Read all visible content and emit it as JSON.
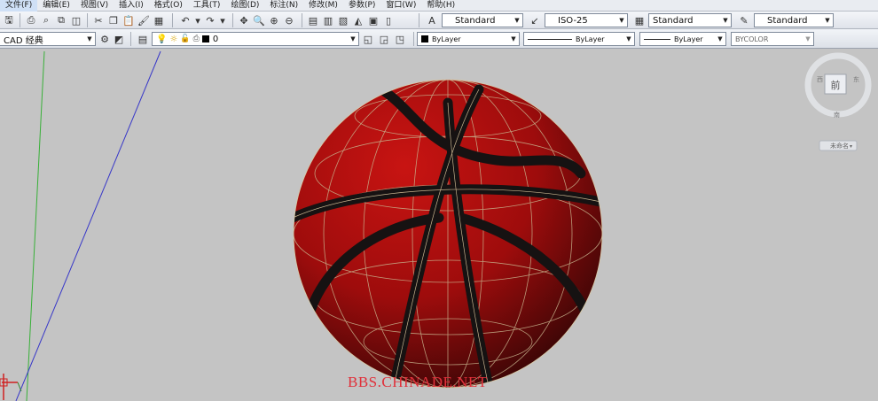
{
  "menu": [
    {
      "label": "文件(F)",
      "active": true
    },
    {
      "label": "编辑(E)"
    },
    {
      "label": "视图(V)"
    },
    {
      "label": "插入(I)"
    },
    {
      "label": "格式(O)"
    },
    {
      "label": "工具(T)"
    },
    {
      "label": "绘图(D)"
    },
    {
      "label": "标注(N)"
    },
    {
      "label": "修改(M)"
    },
    {
      "label": "参数(P)"
    },
    {
      "label": "窗口(W)"
    },
    {
      "label": "帮助(H)"
    }
  ],
  "styles": {
    "text_style": "Standard",
    "dim_style": "ISO-25",
    "table_style": "Standard",
    "mleader_style": "Standard"
  },
  "workspace": "CAD 经典",
  "layer": {
    "name": "0"
  },
  "properties": {
    "color": "ByLayer",
    "linetype": "ByLayer",
    "lineweight": "ByLayer",
    "plotstyle": "BYCOLOR"
  },
  "viewcube": {
    "face_label": "前",
    "ucs_label": "未命名"
  },
  "watermark": "BBS.CHINADE.NET",
  "colors": {
    "ball": "#a40d0d",
    "seam": "#161212",
    "grid": "#c8b58f",
    "background": "#c4c4c4"
  }
}
